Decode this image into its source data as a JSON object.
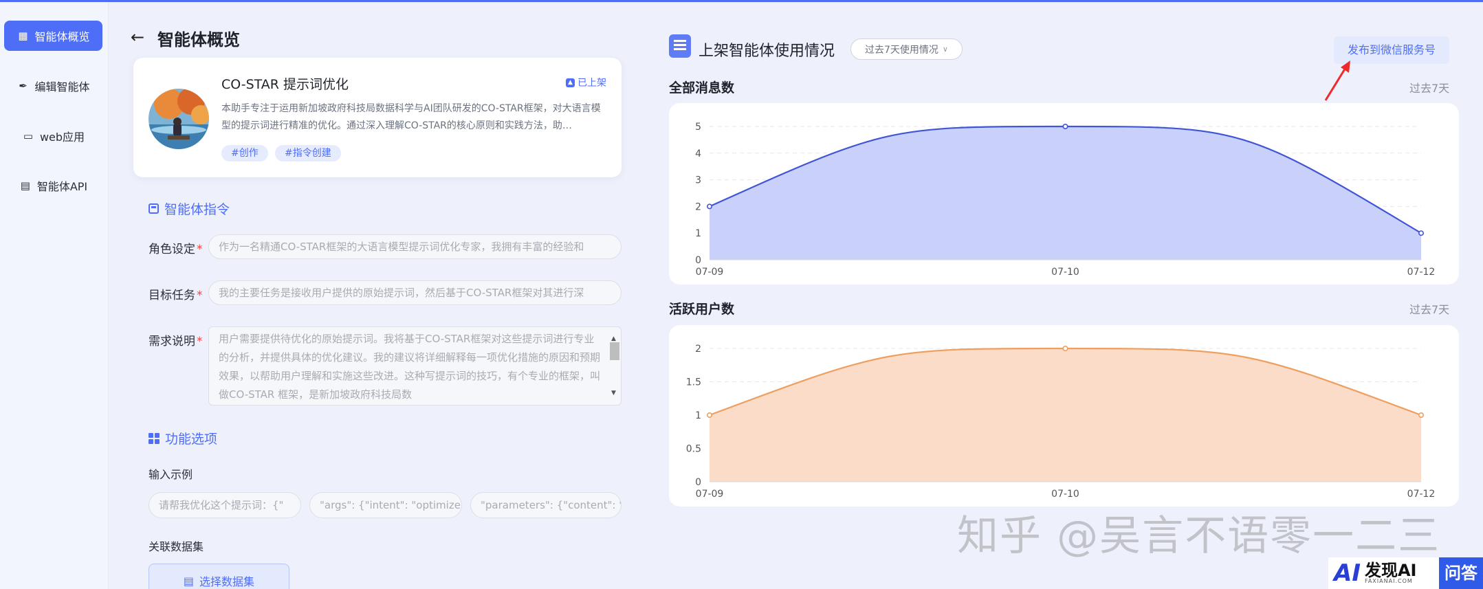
{
  "sidebar": {
    "items": [
      {
        "label": "智能体概览",
        "icon": "grid-icon",
        "active": true
      },
      {
        "label": "编辑智能体",
        "icon": "pen-icon",
        "active": false
      },
      {
        "label": "web应用",
        "icon": "monitor-icon",
        "active": false
      },
      {
        "label": "智能体API",
        "icon": "document-icon",
        "active": false
      }
    ]
  },
  "page": {
    "title": "智能体概览"
  },
  "agent": {
    "name": "CO-STAR 提示词优化",
    "status": "已上架",
    "description": "本助手专注于运用新加坡政府科技局数据科学与AI团队研发的CO-STAR框架，对大语言模型的提示词进行精准的优化。通过深入理解CO-STAR的核心原则和实践方法，助…",
    "tags": [
      "#创作",
      "#指令创建"
    ]
  },
  "instructions": {
    "heading": "智能体指令",
    "role": {
      "label": "角色设定",
      "placeholder": "作为一名精通CO-STAR框架的大语言模型提示词优化专家，我拥有丰富的经验和"
    },
    "task": {
      "label": "目标任务",
      "placeholder": "我的主要任务是接收用户提供的原始提示词，然后基于CO-STAR框架对其进行深"
    },
    "requirement": {
      "label": "需求说明",
      "placeholder": "用户需要提供待优化的原始提示词。我将基于CO-STAR框架对这些提示词进行专业的分析，并提供具体的优化建议。我的建议将详细解释每一项优化措施的原因和预期效果，以帮助用户理解和实施这些改进。这种写提示词的技巧，有个专业的框架，叫做CO-STAR 框架，是新加坡政府科技局数"
    }
  },
  "features": {
    "heading": "功能选项",
    "examples_label": "输入示例",
    "examples": [
      "请帮我优化这个提示词：{\"",
      "\"args\": {\"intent\": \"optimize",
      "\"parameters\": {\"content\": \""
    ],
    "dataset_label": "关联数据集",
    "dataset_button": "选择数据集"
  },
  "usage": {
    "title": "上架智能体使用情况",
    "period_select": "过去7天使用情况",
    "publish_button": "发布到微信服务号"
  },
  "charts": {
    "messages": {
      "title": "全部消息数",
      "period": "过去7天"
    },
    "users": {
      "title": "活跃用户数",
      "period": "过去7天"
    }
  },
  "chart_data": [
    {
      "type": "area",
      "title": "全部消息数",
      "x": [
        "07-09",
        "07-10",
        "07-12"
      ],
      "values": [
        2,
        5,
        1
      ],
      "ylim": [
        0,
        5
      ],
      "yticks": [
        0,
        1,
        2,
        3,
        4,
        5
      ],
      "grid": true,
      "color": "#4055d6",
      "fill": "#c9d1fb"
    },
    {
      "type": "area",
      "title": "活跃用户数",
      "x": [
        "07-09",
        "07-10",
        "07-12"
      ],
      "values": [
        1,
        2,
        1
      ],
      "ylim": [
        0,
        2
      ],
      "yticks": [
        0,
        0.5,
        1,
        1.5,
        2
      ],
      "grid": true,
      "color": "#ee9f5f",
      "fill": "#fbdcc8"
    }
  ],
  "watermark": "知乎 @吴言不语零一二三",
  "branding": {
    "mark": "AI",
    "name": "发现AI",
    "domain": "FAXIANAI.COM",
    "qa": "问答"
  }
}
